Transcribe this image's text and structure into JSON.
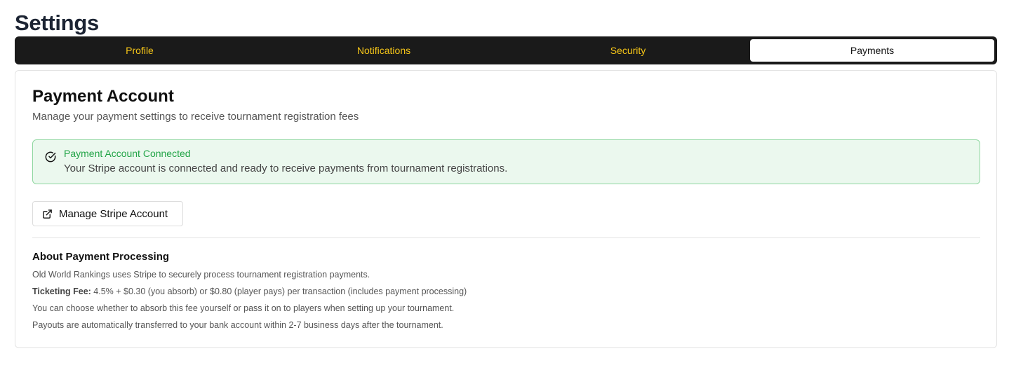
{
  "page": {
    "title": "Settings"
  },
  "tabs": [
    {
      "label": "Profile",
      "active": false
    },
    {
      "label": "Notifications",
      "active": false
    },
    {
      "label": "Security",
      "active": false
    },
    {
      "label": "Payments",
      "active": true
    }
  ],
  "card": {
    "title": "Payment Account",
    "subtitle": "Manage your payment settings to receive tournament registration fees"
  },
  "alert": {
    "icon": "circle-check-icon",
    "title": "Payment Account Connected",
    "text": "Your Stripe account is connected and ready to receive payments from tournament registrations."
  },
  "manage_button": {
    "icon": "external-link-icon",
    "label": "Manage Stripe Account"
  },
  "about": {
    "title": "About Payment Processing",
    "line1": "Old World Rankings uses Stripe to securely process tournament registration payments.",
    "fee_label": "Ticketing Fee:",
    "fee_text": " 4.5% + $0.30 (you absorb) or $0.80 (player pays) per transaction (includes payment processing)",
    "line3": "You can choose whether to absorb this fee yourself or pass it on to players when setting up your tournament.",
    "line4": "Payouts are automatically transferred to your bank account within 2-7 business days after the tournament."
  },
  "colors": {
    "tab_bar": "#1a1a1a",
    "tab_text": "#f5c518",
    "success_bg": "#ebf8ee",
    "success_border": "#8fd7a0",
    "success_text": "#22a447"
  }
}
